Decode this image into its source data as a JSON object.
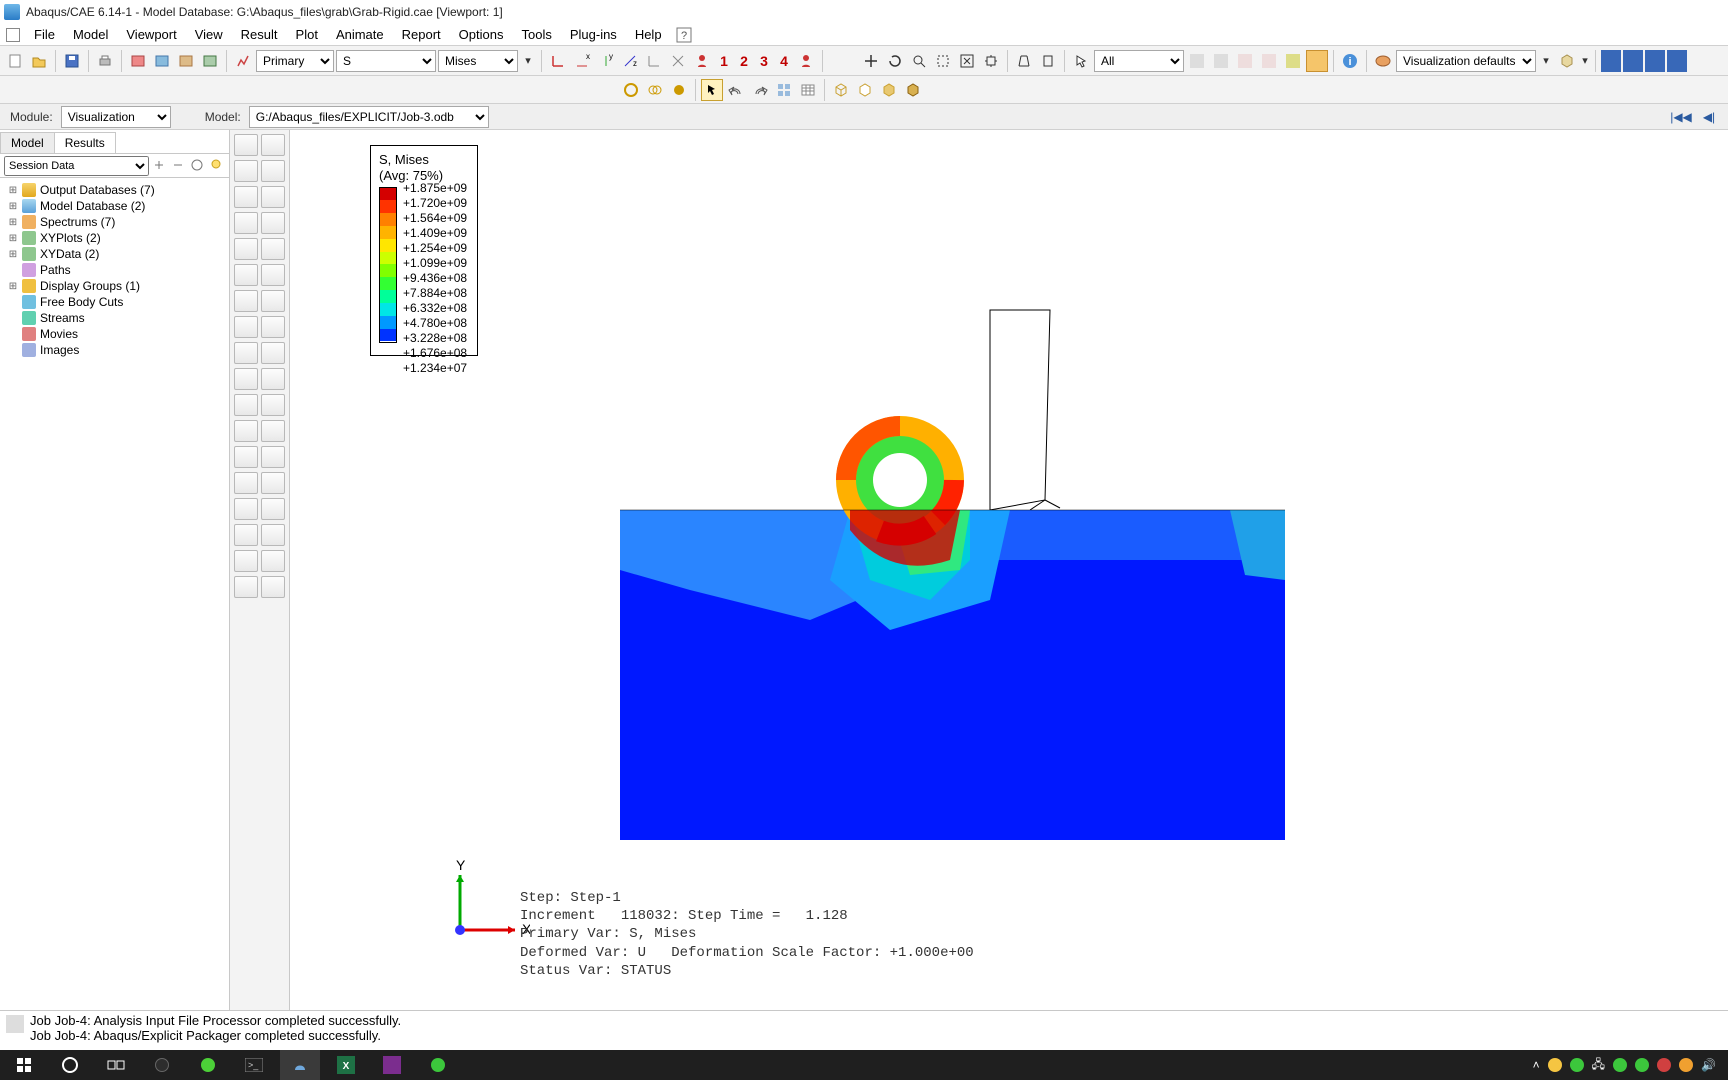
{
  "title": "Abaqus/CAE 6.14-1 - Model Database: G:\\Abaqus_files\\grab\\Grab-Rigid.cae [Viewport: 1]",
  "menu": [
    "File",
    "Model",
    "Viewport",
    "View",
    "Result",
    "Plot",
    "Animate",
    "Report",
    "Options",
    "Tools",
    "Plug-ins",
    "Help"
  ],
  "toolbar1": {
    "primary_label": "Primary",
    "var_letter": "S",
    "invariant": "Mises",
    "nums": [
      "1",
      "2",
      "3",
      "4"
    ],
    "all_label": "All",
    "vis_defaults": "Visualization defaults"
  },
  "module_row": {
    "module_label": "Module:",
    "module_value": "Visualization",
    "model_label": "Model:",
    "model_value": "G:/Abaqus_files/EXPLICIT/Job-3.odb"
  },
  "tree_tabs": [
    "Model",
    "Results"
  ],
  "tree_header": "Session Data",
  "tree_items": [
    {
      "label": "Output Databases (7)",
      "icon": "ic-db",
      "exp": "+"
    },
    {
      "label": "Model Database (2)",
      "icon": "ic-model",
      "exp": "+"
    },
    {
      "label": "Spectrums (7)",
      "icon": "ic-spec",
      "exp": "+"
    },
    {
      "label": "XYPlots (2)",
      "icon": "ic-xy",
      "exp": "+"
    },
    {
      "label": "XYData (2)",
      "icon": "ic-xy",
      "exp": "+"
    },
    {
      "label": "Paths",
      "icon": "ic-path",
      "exp": ""
    },
    {
      "label": "Display Groups (1)",
      "icon": "ic-disp",
      "exp": "+"
    },
    {
      "label": "Free Body Cuts",
      "icon": "ic-cut",
      "exp": ""
    },
    {
      "label": "Streams",
      "icon": "ic-stream",
      "exp": ""
    },
    {
      "label": "Movies",
      "icon": "ic-mov",
      "exp": ""
    },
    {
      "label": "Images",
      "icon": "ic-img",
      "exp": ""
    }
  ],
  "legend": {
    "title": "S, Mises\n(Avg: 75%)",
    "values": [
      "+1.875e+09",
      "+1.720e+09",
      "+1.564e+09",
      "+1.409e+09",
      "+1.254e+09",
      "+1.099e+09",
      "+9.436e+08",
      "+7.884e+08",
      "+6.332e+08",
      "+4.780e+08",
      "+3.228e+08",
      "+1.676e+08",
      "+1.234e+07"
    ],
    "colors": [
      "#d40000",
      "#ff3300",
      "#ff8000",
      "#ffb300",
      "#ffe600",
      "#ccff00",
      "#80ff00",
      "#33ff33",
      "#00ff99",
      "#00e6e6",
      "#0099ff",
      "#0033ff"
    ]
  },
  "step_info": "Step: Step-1\nIncrement   118032: Step Time =   1.128\nPrimary Var: S, Mises\nDeformed Var: U   Deformation Scale Factor: +1.000e+00\nStatus Var: STATUS",
  "axis": {
    "x": "X",
    "y": "Y"
  },
  "messages": [
    "Job Job-4: Analysis Input File Processor completed successfully.",
    "Job Job-4: Abaqus/Explicit Packager completed successfully."
  ],
  "taskbar": {
    "time": ""
  }
}
